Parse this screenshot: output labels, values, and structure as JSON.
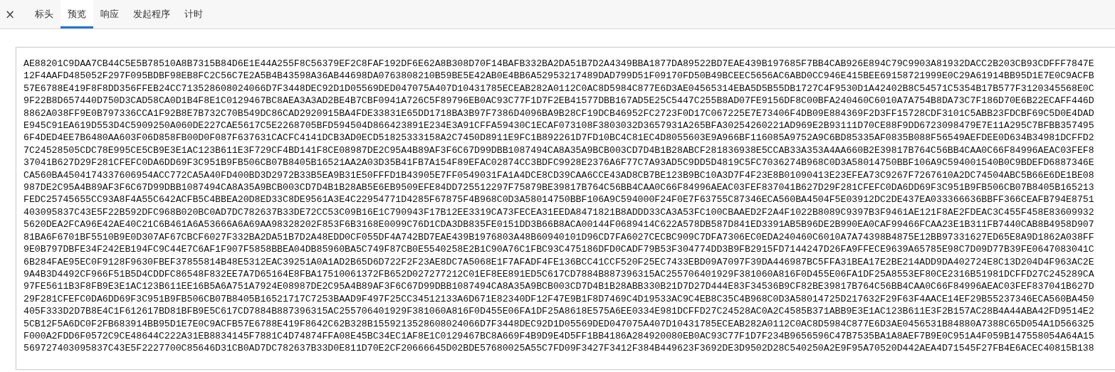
{
  "tabs": [
    {
      "label": "标头",
      "selected": false
    },
    {
      "label": "预览",
      "selected": true
    },
    {
      "label": "响应",
      "selected": false
    },
    {
      "label": "发起程序",
      "selected": false
    },
    {
      "label": "计时",
      "selected": false
    }
  ],
  "close": "×",
  "preview": {
    "lines": [
      "AE88201C9DAA7CB44C5E5B78510A8B7315B84D6E1E44A255F8C56379EF2C8FAF192DF6E62A8B308D70F14BAFB332BA2DA51B7D2A4349BBA1877DA89522BD7EAE439B197685F7BB4CAB926E894C79C9903A81932DACC2B203CB93CDFFF7847E",
      "12F4AAFD485052F297F095BDBF98EB8FC2C56C7E2A5B4B43598A36AB44698DA0763808210B59BE5E42AB0E4BB6A52953217489DAD799D51F09170FD50B49BCEEC5656AC6ABD0CC946E415BEE69158721999E0C29A61914BB95D1E7E0C9ACFB",
      "57E6788E419F8F8DD356FFEB24CC713528608024066D7F3448DEC92D1D05569DED047075A407D10431785ECEAB282A0112C0AC8D5984C877E6D3AE04565314EBA5D5B55DB1727C4F9530D1A42402B8C54571C5354B17B577F3120345568E0C",
      "9F22B8D657440D750D3CAD58CA0D1B4F8E1C0129467BC8AEA3A3AD2BE4B7CBF0941A726C5F89796EB0AC93C77F1D7F2EB41577DBB167AD5E25C5447C255B8AD07FE9156DF8C00BFA240460C6010A7A754B8DA73C7F186D70E6B22ECAFF446D",
      "8862A038FF9E0B797336CCA1F92B8E7B732C70B549DC86CAD2920915BA4FDE33831E65DD1718BA3B97F7386D4096BA9B28CF19DCB46952FC2723F0D17C067225E7E73406F4DB09E884369F2D3FF15728CDF3101C5ABB23FDCBF69C5D0E4DAD",
      "E945C91EA619D553D4C5909250A060DE227CAE5617C5E2268705BFD594504D866423891E234E3A91CFFA59430C1ECAF073108F3803032D3657931A265BFA30254260221AD969E2B93111D70CE88F9DD6723098479E7E11A295C7BFBB357495",
      "6F4DED4EE7B6480AA603F06D858FB00D0F087F637631CACFC4141DCB3AD0ECD51825333158A2C7450D8911E9FC1B892261D7FD10BC4C81EC4D8055603E9A966BF116085A9752A9C6BD85335AF0835B088F56549AEFDEE0D634B34981DCFFD2",
      "7C24528505CDC78E995CE5CB9E3E1AC123B611E3F729CF4BD141F8CE08987DE2C95A4B89AF3F6C67D99DBB1087494CA8A35A9BCB003CD7D4B1B28ABCF281836938E5CCAB33A353A4AA660B2E39817B764C56BB4CAA0C66F84996AEAC03FEF8",
      "37041B627D29F281CFEFC0DA6DD69F3C951B9FB506CB07B8405B16521AA2A03D35B41FB7A154F89EFAC02874CC3BDFC9928E2376A6F77C7A93AD5C9DD5D4819C5FC7036274B968C0D3A58014750BBF106A9C594001540B0C9BDEFD6887346E",
      "CA560BA4504174337606954ACC772CA5A40FD400BD3D2972B33B5EA9B31E50FFFD1B43905E7FF0549031FA1A4DCE8CD39CAA6CCE43AD8CB7BE123B9BC10A3D7F4F23E8B01090413E23EFEA73C9267F7267610A2DC74504ABC5B66E6DE1BE08",
      "987DE2C95A4B89AF3F6C67D99DBB1087494CA8A35A9BCB003CD7D4B1B28AB5E6EB9509EFE84DD725512297F75879BE39817B764C56BB4CAA0C66F84996AEAC03FEF837041B627D29F281CFEFC0DA6DD69F3C951B9FB506CB07B8405B165213",
      "FEDC25745655CC93A8F4A55C642ACFB5C4BBEA20D8ED33C8DE9561A3E4C22954771D4285F67875F4B968C0D3A58014750BBF106A9C594000F24F0E7F63755C87346ECA560BA4504F5E03912DC2DE437EA033366636BBFF366CEAFB794E8751",
      "403095837C43E5F22B592DFC968B020BC0AD7DC782637B33DE72CC53C09B16E1C790943F17B12EE3319CA73FECEA31EEDA8471821B8ADDD33CA3A53FC100CBAAED2F2A4F1022B8089C9397B3F9461AE121F8AE2FDEAC3C455F458E83609932",
      "5620DEA2FCA96E42AE40C21C6B461A6A53666A6A69AA98328202F853F6B3168E0099C76D1CDA3DB835FE0151DD3B66B8ACA00144F0689414C622A578DB587D841ED3391AB5B96DE2B990EA0CAF99466FCAA23E1B311FB7440CAB8B4958D907",
      "81BA6F6701BF5510B9E0D307AF67CBCF6027F332BA2DA51B7D2A48EDD0CF055DF4A742BD7EAE439B1976803A48B60940101D96CD7FA6027CECBC909C7DFA7306EC0EDA240460C6010A7A74398B4875E12BB97331627ED65E8A9D1862A038FF",
      "9E0B797DBFE34F242EB194FC9C44E7C6AF1F907F5858BBEA04DB85960BA5C749F87CB0E5540258E2B1C90A76C1FBC93C475186DFD0CADF79B53F304774DD3B9FB2915FD7144247D26FA9FFECE9639A65785E98C7D09D77B39FE0647083041C",
      "6B284FAE95EC0F9128F9630FBEF37855814B48E5312EAC39251A0A1AD2B65D6D722F2F23AE8DC7A5068E1F7AFADF4FE136BCC41CCF520F25EC7433EBD09A7097F39DA446987BC5FFA31BEA17E2BE214ADD9DA402724E8C13D204D4F963AC2E",
      "9A4B3D4492CF966F51B5D4CDDFC86548F832EE7A7D65164E8FBA17510061372FB652D027277212C01EF8EE891ED5C617CD7884B887396315AC255706401929F381060A816F0D455E06FA1DF25A8553EF80CE2316B51981DCFFD27C245289CA",
      "97FE5611B3F8FB9E3E1AC123B611EE16B5A6A751A7924E08987DE2C95A4B89AF3F6C67D99DBB1087494CA8A35A9BCB003CD7D4B1B28ABB330B21D7D27D444E83F34536B9CF82BE39817B764C56BB4CAA0C66F84996AEAC03FEF837041B627D",
      "29F281CFEFC0DA6DD69F3C951B9FB506CB07B8405B16521717C7253BAAD9F497F25CC34512133A6D671E82340DF12F47E9B1F8D7469C4D19533AC9C4EB8C35C4B968C0D3A58014725D217632F29F63F4AACE14EF29B55237346ECA560BA450",
      "405F333D2D7B8E4C1F612617BD81BFB9E5C617CD7884B887396315AC255706401929F381060A816F0D455E06FA1DF25A8618E575A6EE0334E981DCFFD27C24528AC0A2C4585B371ABB9E3E1AC123B611E3F2B157AC28B4A44ABA42FD9514E2",
      "5CB12F5A6DC0F2FB683914BB95D1E7E0C9ACFB57E6788E419F8642C62B328B1559213528608024066D7F3448DEC92D1D05569DED047075A407D10431785ECEAB282A0112C0AC8D5984C877E6D3AE0456531B84880A7388C65D054A1D566325",
      "F000A2FDD6F0572C9CE48644C222A31EB8834145F7881C4D74874FFA08E45BC34EC1AF8E1C0129467BC8A669F4B9D9E4D5FF1BB4186A284920080EB0AC93C77F1D7F234B9656596C47B7535BA1A8AEF7B9E0C951A4F059B147558054A64A15",
      "569727403095837C43E5F2227700C85646D31CB0AD7DC782637B33D0E811D70E2CF20666645D02BDE57680025A55C7FD09F3427F3412F384B449623F3692DE3D9502D28C540250A2E9F95A70520D442AEA4D71545F27FB4E6ACEC40815B138"
    ]
  }
}
